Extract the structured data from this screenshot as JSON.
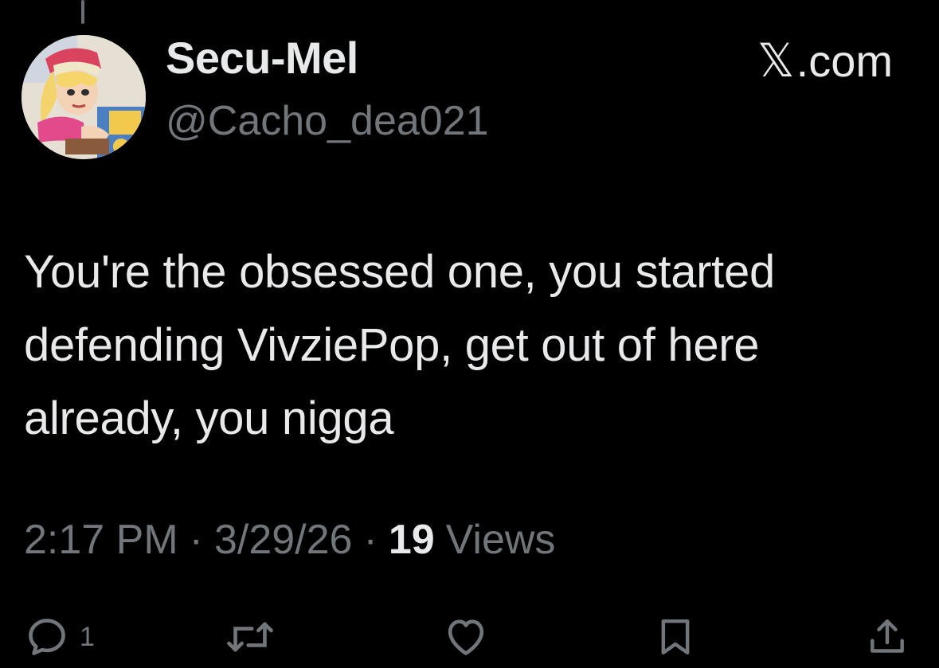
{
  "post": {
    "display_name": "Secu-Mel",
    "handle": "@Cacho_dea021",
    "brand": "X.com",
    "brand_mark": "𝕏",
    "brand_suffix": ".com",
    "text": "You're the obsessed one, you started defending VivziePop, get out of here already, you nigga",
    "time": "2:17 PM",
    "date": "3/29/26",
    "separator": "·",
    "views_count": "19",
    "views_label": "Views"
  },
  "actions": {
    "reply": {
      "icon": "reply-icon",
      "count": "1"
    },
    "repost": {
      "icon": "repost-icon"
    },
    "like": {
      "icon": "heart-icon"
    },
    "bookmark": {
      "icon": "bookmark-icon"
    },
    "share": {
      "icon": "share-icon"
    }
  },
  "colors": {
    "background": "#000000",
    "primary_text": "#e7e9ea",
    "secondary_text": "#71767b"
  }
}
